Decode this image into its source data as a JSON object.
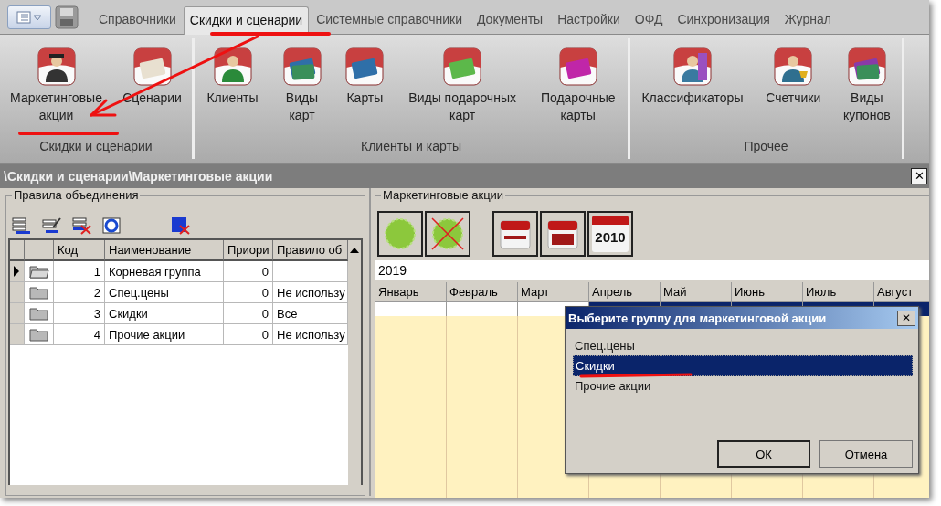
{
  "ribbon": {
    "tabs": [
      {
        "label": "Справочники",
        "selected": false
      },
      {
        "label": "Скидки и сценарии",
        "selected": true
      },
      {
        "label": "Системные справочники",
        "selected": false
      },
      {
        "label": "Документы",
        "selected": false
      },
      {
        "label": "Настройки",
        "selected": false
      },
      {
        "label": "ОФД",
        "selected": false
      },
      {
        "label": "Синхронизация",
        "selected": false
      },
      {
        "label": "Журнал",
        "selected": false
      }
    ],
    "groups": [
      {
        "label": "Скидки и сценарии",
        "buttons": [
          {
            "label": "Маркетинговые\nакции",
            "kind": "graduate"
          },
          {
            "label": "Сценарии",
            "kind": "documents"
          }
        ]
      },
      {
        "label": "Клиенты и карты",
        "buttons": [
          {
            "label": "Клиенты",
            "kind": "person"
          },
          {
            "label": "Виды\nкарт",
            "kind": "cards"
          },
          {
            "label": "Карты",
            "kind": "card"
          },
          {
            "label": "Виды подарочных\nкарт",
            "kind": "gift-card"
          },
          {
            "label": "Подарочные\nкарты",
            "kind": "bow-card"
          }
        ]
      },
      {
        "label": "Прочее",
        "buttons": [
          {
            "label": "Классификаторы",
            "kind": "classifier"
          },
          {
            "label": "Счетчики",
            "kind": "trophy"
          },
          {
            "label": "Виды\nкупонов",
            "kind": "coupons"
          }
        ]
      }
    ]
  },
  "window": {
    "title": "\\Скидки и сценарии\\Маркетинговые акции",
    "close": "✕"
  },
  "rules_panel": {
    "title": "Правила объединения",
    "columns": [
      "Код",
      "Наименование",
      "Приори",
      "Правило об"
    ],
    "rows": [
      {
        "current": true,
        "folder_open": true,
        "code": "1",
        "name": "Корневая группа",
        "priority": "0"
      },
      {
        "current": false,
        "folder_open": false,
        "code": "2",
        "name": "Спец.цены",
        "priority": "0",
        "rule": "Не использу"
      },
      {
        "current": false,
        "folder_open": false,
        "code": "3",
        "name": "Скидки",
        "priority": "0",
        "rule": "Все"
      },
      {
        "current": false,
        "folder_open": false,
        "code": "4",
        "name": "Прочие акции",
        "priority": "0",
        "rule": "Не использу"
      }
    ]
  },
  "actions_panel": {
    "title": "Маркетинговые акции",
    "tools": [
      {
        "kind": "sale"
      },
      {
        "kind": "sale-delete"
      },
      {
        "kind": "month"
      },
      {
        "kind": "grid"
      },
      {
        "kind": "year",
        "label": "2010"
      }
    ],
    "year": "2019",
    "months": [
      "Январь",
      "Февраль",
      "Март",
      "Апрель",
      "Май",
      "Июнь",
      "Июль",
      "Август"
    ]
  },
  "dialog": {
    "title": "Выберите группу для маркетинговой акции",
    "close": "✕",
    "items": [
      {
        "label": "Спец.цены",
        "selected": false
      },
      {
        "label": "Скидки",
        "selected": true
      },
      {
        "label": "Прочие акции",
        "selected": false
      }
    ],
    "buttons": [
      "ОК",
      "Отмена"
    ]
  }
}
